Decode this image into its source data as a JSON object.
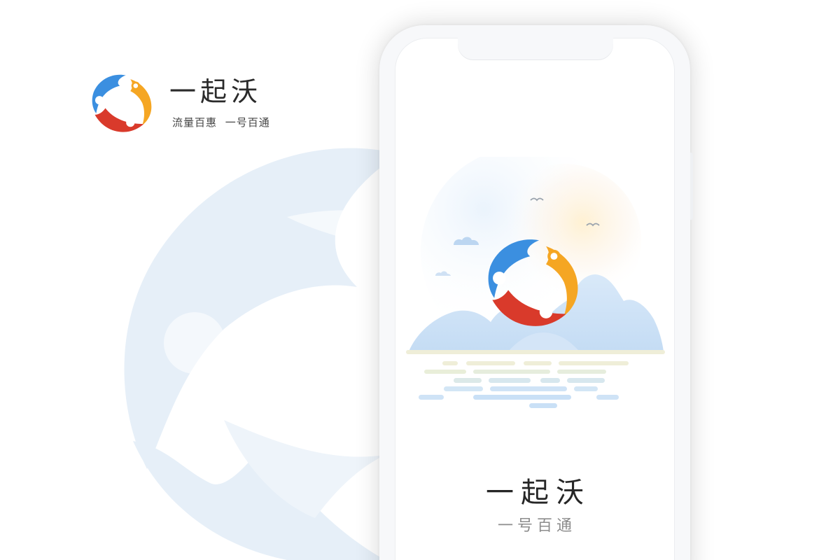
{
  "brand": {
    "name": "一起沃",
    "tagline": "流量百惠  一号百通"
  },
  "splash": {
    "title": "一起沃",
    "subtitle": "一号百通"
  },
  "colors": {
    "logo_blue": "#3b8fe0",
    "logo_orange": "#f5a623",
    "logo_red": "#d93a2b",
    "watermark": "#e4eef8",
    "mountain": "#cfe2f6",
    "water_sand": "#efeed8",
    "water_blue": "#cbe3f7"
  },
  "icons": {
    "logo": "three-people-circle-logo",
    "bird": "bird-icon",
    "cloud": "cloud-icon"
  }
}
